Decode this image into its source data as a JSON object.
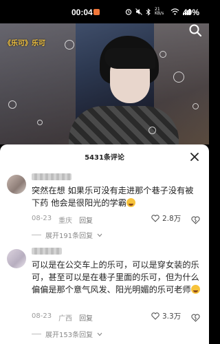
{
  "status_bar": {
    "time": "00:04",
    "network": "21 KB/s",
    "battery": "40%"
  },
  "video": {
    "title": "《乐可》乐可"
  },
  "comments_panel": {
    "title": "5431条评论",
    "comments": [
      {
        "text": "突然在想 如果乐可没有走进那个巷子没有被下药 他会是很阳光的学霸",
        "date": "08-23",
        "location": "重庆",
        "reply_label": "回复",
        "likes": "2.8万",
        "expand_label": "展开191条回复"
      },
      {
        "text": "可以是在公交车上的乐可，可以是穿女装的乐可，甚至可以是在巷子里面的乐可，但为什么偏偏是那个意气风发、阳光明媚的乐可老师",
        "date": "08-23",
        "location": "广西",
        "reply_label": "回复",
        "likes": "3.3万",
        "expand_label": "展开153条回复"
      }
    ]
  }
}
